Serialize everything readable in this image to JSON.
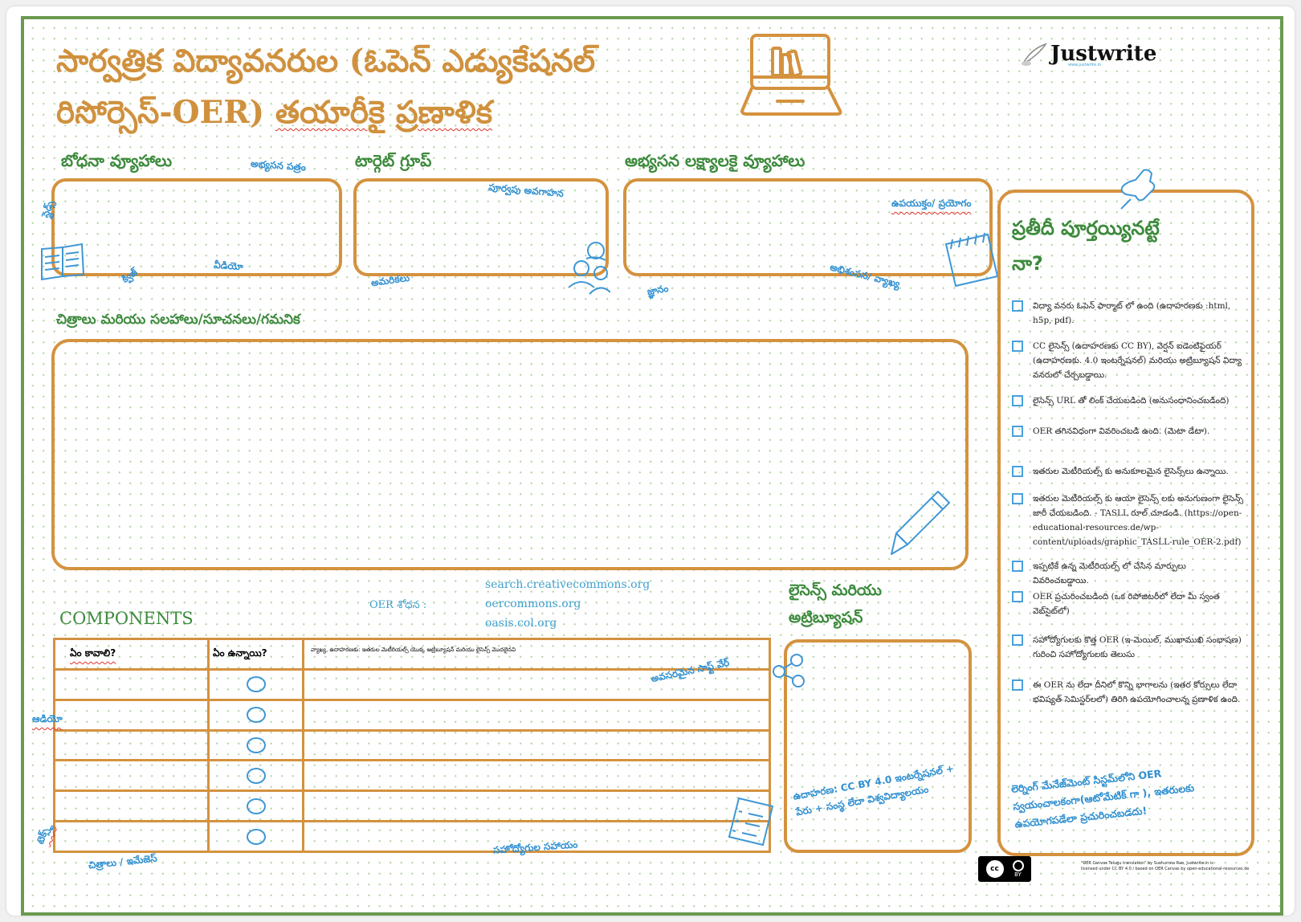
{
  "header": {
    "title_line1": "సార్వత్రిక విద్యావనరుల (ఓపెన్ ఎడ్యుకేషనల్",
    "title_line2_a": "రిసోర్సెస్-OER)",
    "title_line2_b": "తయారీకై",
    "title_line2_c": "ప్రణాళిక",
    "logo": "Justwrite",
    "logo_sub": "www.justwrite.in"
  },
  "sections": {
    "teaching": {
      "heading": "బోధనా వ్యూహాలు",
      "notes": [
        "అభ్యసన పత్రం",
        "స్లైడ్స్",
        "క్విజ్",
        "వీడియో"
      ]
    },
    "target": {
      "heading": "టార్గెట్ గ్రూప్",
      "notes": [
        "పూర్వపు అవగాహన",
        "అమరికలు"
      ]
    },
    "goals": {
      "heading": "అభ్యసన లక్ష్యాలకై వ్యూహాలు",
      "notes": [
        "ఉపయుక్తం/ ప్రయోగం",
        "జ్ఞానం",
        "అభిశంసన/ వ్యాఖ్య"
      ]
    },
    "images": {
      "heading": "చిత్రాలు మరియు సలహాలు/సూచనలు/గమనిక"
    },
    "components": {
      "heading": "COMPONENTS",
      "oer_search_label": "OER శోధన :",
      "links": [
        "search.creativecommons.org",
        "oercommons.org",
        "oasis.col.org"
      ],
      "columns": [
        "ఏం కావాలి?",
        "ఏం ఉన్నాయి?",
        "వ్యాఖ్య, ఉదాహరణకు: ఇతరుల మెటీరియల్స్ యొక్క అట్రిబ్యూషన్ మరియు లైసెన్స్ మొదలైనవి"
      ],
      "row_count": 6,
      "notes": [
        "అవసరమైన సాఫ్ట్ వేర్",
        "ఆడియో",
        "టెక్స్ట్",
        "చిత్రాలు / ఇమేజెస్",
        "సహోద్యోగుల సహాయం"
      ]
    },
    "license": {
      "heading_line1": "లైసెన్స్ మరియు",
      "heading_line2": "అట్రిబ్యూషన్",
      "example": "ఉదాహరణ: CC BY 4.0 ఇంటర్నేషనల్ + పేరు + సంస్థ లేదా విశ్వవిద్యాలయం"
    },
    "checklist": {
      "heading_line1": "ప్రతీదీ పూర్తయ్యినట్టే",
      "heading_line2": "నా?",
      "items": [
        {
          "text": "విద్యా వనరు ఓపెన్ ఫార్మాట్ లో ఉంది (ఉదాహరణకు :html, h5p, pdf).",
          "checked": false
        },
        {
          "text": "CC లైసెన్స్ (ఉదాహరణకు CC BY), వెర్షన్ ఐడెంటిఫైయర్ (ఉదాహరణకు. 4.0 ఇంటర్నేషనల్) మరియు అట్రిబ్యూషన్ విద్యా వనరులో చేర్చబడ్డాయి.",
          "checked": false
        },
        {
          "text": "లైసెన్స్ URL తో లింక్ చేయబడింది (అనుసంధానించబడింది)",
          "checked": false
        },
        {
          "text": "OER తగినవిధంగా వివరించబడి ఉంది. (మెటా డేటా).",
          "checked": false
        },
        {
          "text": "ఇతరుల మెటీరియల్స్ కు అనుకూలమైన లైసెన్స్‌లు ఉన్నాయి.",
          "checked": false
        },
        {
          "text": "ఇతరుల మెటీరియల్స్ కు ఆయా లైసెన్స్ లకు అనుగుణంగా లైసెన్స్ జారీ చేయబడింది. - TASLL రూల్ చూడండి. (https://open-educational-resources.de/wp-content/uploads/graphic_TASLL-rule_OER-2.pdf)",
          "checked": false
        },
        {
          "text": "ఇప్పటికే ఉన్న మెటీరియల్స్ లో చేసిన మార్పులు వివరించబడ్డాయి.",
          "checked": false
        },
        {
          "text": "OER ప్రచురించబడింది (ఒక రిపోజిటరీలో లేదా మీ స్వంత వెబ్‌సైట్‌లో)",
          "checked": false
        },
        {
          "text": "సహోద్యోగులకు కొత్త OER (ఇ-మెయిల్, ముఖాముఖి సంభాషణ) గురించి సహోద్యోగులకు తెలుసు",
          "checked": false
        },
        {
          "text": "ఈ OER ను లేదా దీనిలో కొన్ని భాగాలను (ఇతర కోర్సులు లేదా భవిష్యత్ సెమిస్టర్‌లలో) తిరిగి ఉపయోగించాలన్న ప్రణాళిక ఉంది.",
          "checked": false
        }
      ],
      "lms_note": "లెర్నింగ్ మేనేజ్‌మెంట్ సిస్టమ్‌లోని OER స్వయంచాలకంగా(ఆటోమేటిక్ గా ), ఇతరులకు ఉపయోగపడేలా ప్రచురించబడదు!"
    }
  },
  "footer": {
    "cc_badge": "BY",
    "credit_line1": "\"OER Canvas Telugu translation\" by Sushumna Rao, Justwrite.in is",
    "credit_line2": "licensed under CC BY 4.0 / based on OER Canvas by open-educational-resources.de"
  },
  "colors": {
    "frame_green": "#6a9a4f",
    "title_orange": "#d0913e",
    "heading_green": "#3d8a3d",
    "box_orange": "#d4923f",
    "note_blue": "#2f8fd0"
  }
}
